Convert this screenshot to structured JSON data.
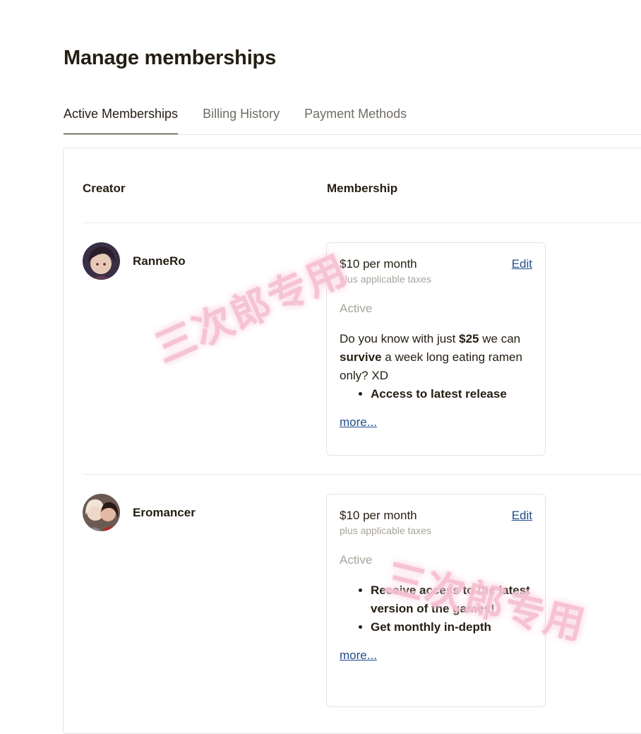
{
  "page": {
    "title": "Manage memberships"
  },
  "tabs": [
    {
      "label": "Active Memberships",
      "active": true
    },
    {
      "label": "Billing History",
      "active": false
    },
    {
      "label": "Payment Methods",
      "active": false
    }
  ],
  "table": {
    "headers": {
      "creator": "Creator",
      "membership": "Membership"
    }
  },
  "memberships": [
    {
      "creator": "RanneRo",
      "price": "$10 per month",
      "edit_label": "Edit",
      "taxes": "plus applicable taxes",
      "status": "Active",
      "description": {
        "t1": "Do you know with just ",
        "b1": "$25",
        "t2": " we can ",
        "b2": "survive",
        "t3": " a week long eating ramen only? XD"
      },
      "perks": [
        "Access to latest release"
      ],
      "more_label": "more..."
    },
    {
      "creator": "Eromancer",
      "price": "$10 per month",
      "edit_label": "Edit",
      "taxes": "plus applicable taxes",
      "status": "Active",
      "perks": [
        "Receive access to the latest version of the games!",
        "Get monthly in-depth"
      ],
      "more_label": "more..."
    }
  ],
  "watermark": {
    "text": "三次郎专用"
  }
}
